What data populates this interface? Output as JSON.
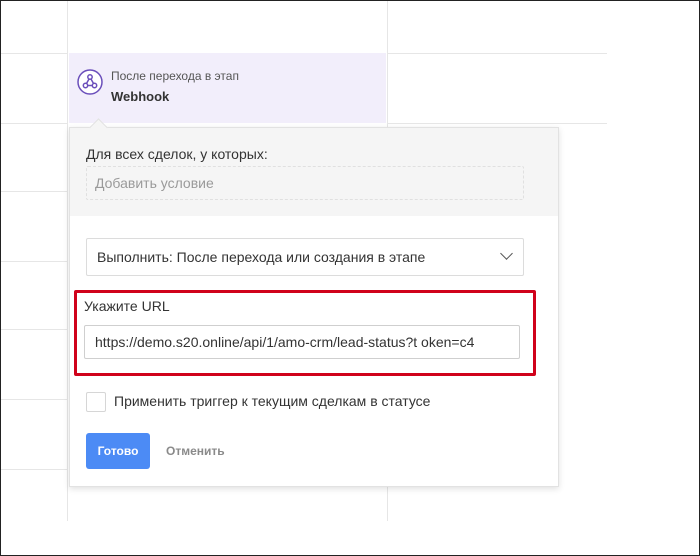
{
  "trigger": {
    "caption": "После перехода в этап",
    "title": "Webhook"
  },
  "popup": {
    "condition_label": "Для всех сделок, у которых:",
    "condition_placeholder": "Добавить условие",
    "execute_select_value": "Выполнить: После перехода или создания в этапе",
    "url_label": "Укажите URL",
    "url_value": "https://demo.s20.online/api/1/amo-crm/lead-status?t oken=c4",
    "apply_checkbox_label": "Применить триггер к текущим сделкам в статусе",
    "apply_checked": false,
    "done_label": "Готово",
    "cancel_label": "Отменить"
  },
  "colors": {
    "accent": "#4c8bf5",
    "highlight": "#d0021b",
    "trigger_bg": "#f2eefb",
    "webhook_icon": "#6b4fbb"
  },
  "icons": {
    "trigger": "webhook-icon",
    "select": "chevron-down-icon"
  }
}
